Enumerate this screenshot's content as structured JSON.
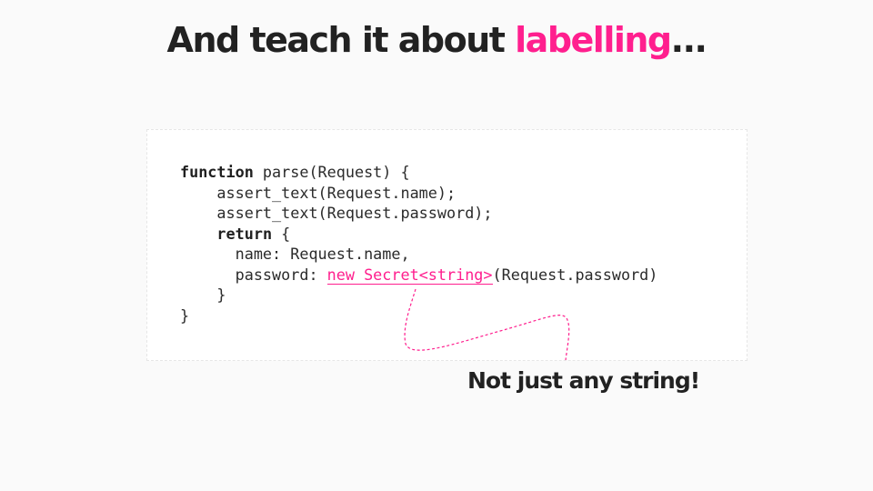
{
  "title": {
    "prefix": "And teach it about ",
    "highlight": "labelling",
    "suffix": "..."
  },
  "code": {
    "line1_kw": "function",
    "line1_rest": " parse(Request) {",
    "line2": "    assert_text(Request.name);",
    "line3": "    assert_text(Request.password);",
    "line4_indent": "    ",
    "line4_kw": "return",
    "line4_rest": " {",
    "line5": "      name: Request.name,",
    "line6_prefix": "      password: ",
    "line6_secret": "new Secret<string>",
    "line6_suffix": "(Request.password)",
    "line7": "    }",
    "line8": "}"
  },
  "annotation": {
    "callout": "Not just any string!",
    "accent_color": "#ff1f8e"
  }
}
